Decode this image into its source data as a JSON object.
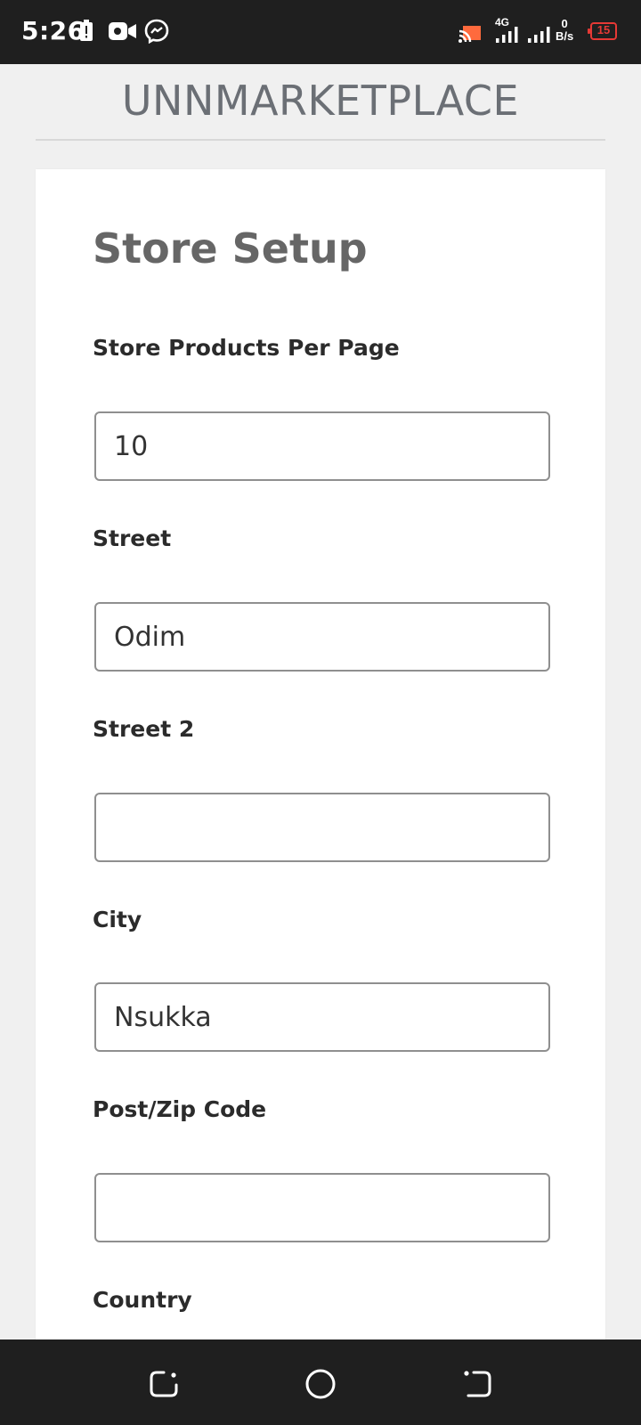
{
  "status_bar": {
    "time": "5:26",
    "network_type": "4G",
    "speed_value": "0",
    "speed_unit": "B/s",
    "battery_level": "15",
    "icons": [
      "battery-saver-icon",
      "video-camera-icon",
      "messenger-icon",
      "cast-icon",
      "signal-icon",
      "signal-icon",
      "battery-icon"
    ]
  },
  "header": {
    "brand": "UNNMARKETPLACE"
  },
  "form": {
    "title": "Store Setup",
    "fields": [
      {
        "label": "Store Products Per Page",
        "value": "10"
      },
      {
        "label": "Street",
        "value": "Odim"
      },
      {
        "label": "Street 2",
        "value": ""
      },
      {
        "label": "City",
        "value": "Nsukka"
      },
      {
        "label": "Post/Zip Code",
        "value": ""
      },
      {
        "label": "Country",
        "value": ""
      }
    ]
  },
  "nav_bar": {
    "icons": [
      "recent-apps-icon",
      "home-icon",
      "back-icon"
    ]
  },
  "colors": {
    "status_bar_bg": "#1f1f1f",
    "page_bg": "#f0f0f0",
    "card_bg": "#ffffff",
    "battery_low": "#e53935",
    "cast_accent": "#ff6a3d"
  }
}
